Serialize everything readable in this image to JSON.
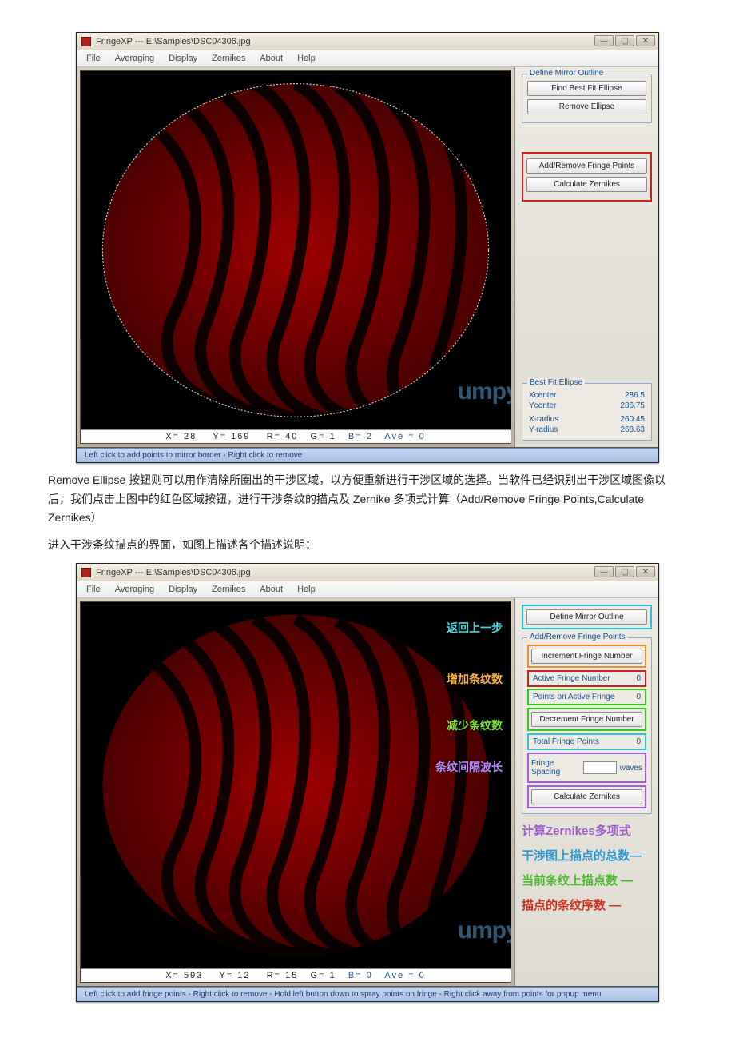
{
  "window": {
    "title": "FringeXP --- E:\\Samples\\DSC04306.jpg",
    "controls": {
      "min": "—",
      "max": "▢",
      "close": "✕"
    }
  },
  "menu": [
    "File",
    "Averaging",
    "Display",
    "Zernikes",
    "About",
    "Help"
  ],
  "screenshot1": {
    "readout": {
      "x": "X= 28",
      "y": "Y= 169",
      "r": "R= 40",
      "g": "G= 1",
      "b": "B= 2",
      "ave": "Ave = 0"
    },
    "panel": {
      "define_outline_legend": "Define Mirror Outline",
      "find_btn": "Find Best Fit Ellipse",
      "remove_btn": "Remove Ellipse",
      "add_remove_btn": "Add/Remove Fringe Points",
      "calc_btn": "Calculate Zernikes",
      "bestfit_legend": "Best Fit Ellipse",
      "stats": {
        "xc_label": "Xcenter",
        "xc": "286.5",
        "yc_label": "Ycenter",
        "yc": "286.75",
        "xr_label": "X-radius",
        "xr": "260.45",
        "yr_label": "Y-radius",
        "yr": "268.63"
      }
    },
    "status": "Left click to add points to mirror border  -  Right click to remove",
    "watermark": "umpywong.com"
  },
  "para1": "Remove Ellipse 按钮则可以用作清除所圈出的干涉区域，以方便重新进行干涉区域的选择。当软件已经识别出干涉区域图像以后，我们点击上图中的红色区域按钮，进行干涉条纹的描点及 Zernike 多项式计算（Add/Remove Fringe Points,Calculate Zernikes）",
  "para2": "进入干涉条纹描点的界面，如图上描述各个描述说明：",
  "screenshot2": {
    "readout": {
      "x": "X= 593",
      "y": "Y= 12",
      "r": "R= 15",
      "g": "G= 1",
      "b": "B= 0",
      "ave": "Ave = 0"
    },
    "panel": {
      "define_outline_btn": "Define Mirror Outline",
      "group_legend": "Add/Remove Fringe Points",
      "inc_btn": "Increment Fringe Number",
      "active_label": "Active Fringe Number",
      "active_val": "0",
      "points_label": "Points on Active Fringe",
      "points_val": "0",
      "dec_btn": "Decrement Fringe Number",
      "total_label": "Total Fringe Points",
      "total_val": "0",
      "spacing_label": "Fringe Spacing",
      "spacing_unit": "waves",
      "calc_btn": "Calculate Zernikes"
    },
    "annotations": {
      "back": "返回上一步",
      "inc": "增加条纹数",
      "dec": "减少条纹数",
      "spacing": "条纹间隔波长",
      "calcZ": "计算Zernikes多项式",
      "totalPts": "干涉图上描点的总数",
      "activePts": "当前条纹上描点数",
      "fringeNum": "描点的条纹序数"
    },
    "status": "Left click to add fringe points  -  Right click to remove  -  Hold left button down to spray points on fringe  -  Right click away from points for popup menu",
    "watermark": "umpywong.com"
  }
}
